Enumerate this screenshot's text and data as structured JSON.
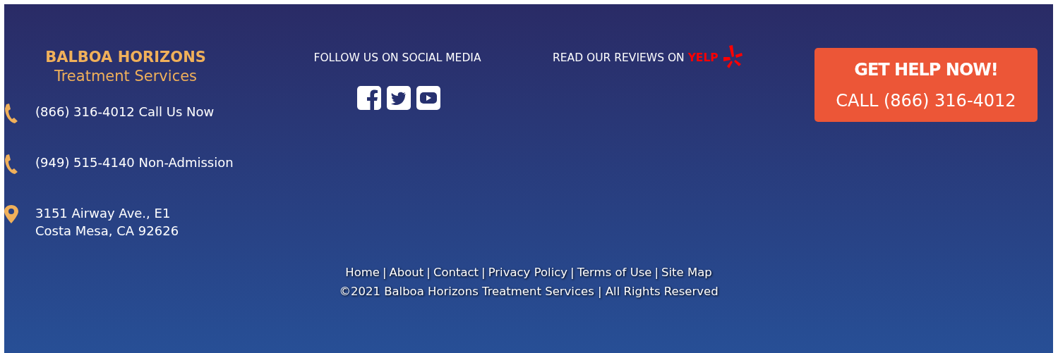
{
  "brand": {
    "name": "BALBOA HORIZONS",
    "tagline": "Treatment Services"
  },
  "contacts": [
    {
      "kind": "phone",
      "lines": [
        "(866) 316-4012 Call Us Now"
      ]
    },
    {
      "kind": "phone",
      "lines": [
        "(949) 515-4140 Non-Admission"
      ]
    },
    {
      "kind": "location",
      "lines": [
        "3151 Airway Ave., E1",
        "Costa Mesa, CA 92626"
      ]
    }
  ],
  "social": {
    "heading": "FOLLOW US ON SOCIAL MEDIA",
    "icons": [
      {
        "kind": "facebook"
      },
      {
        "kind": "twitter"
      },
      {
        "kind": "youtube"
      }
    ]
  },
  "reviews": {
    "label": "READ OUR REVIEWS ON",
    "brand": "YELP"
  },
  "cta": {
    "title": "GET HELP NOW!",
    "subtitle": "CALL (866) 316-4012"
  },
  "footer_links": [
    "Home",
    "About",
    "Contact",
    "Privacy Policy",
    "Terms of Use",
    "Site Map"
  ],
  "separator": "|",
  "copyright": "©2021 Balboa Horizons Treatment Services | All Rights Reserved"
}
